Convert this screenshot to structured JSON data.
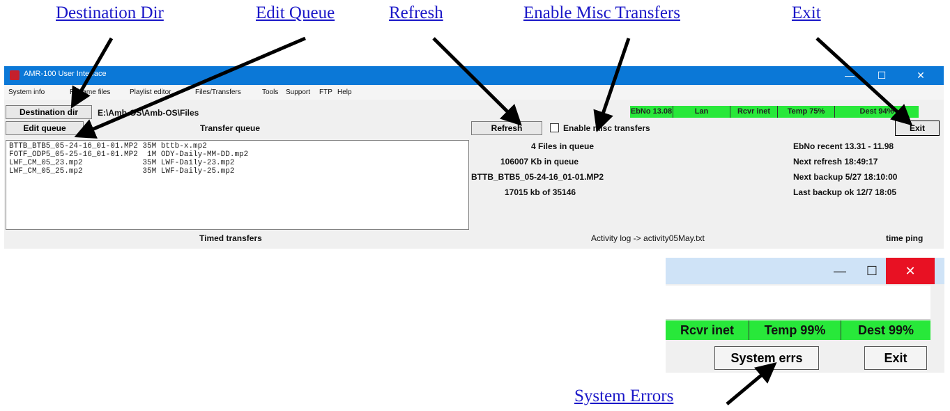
{
  "annotations": {
    "destination_dir": "Destination Dir",
    "edit_queue": "Edit Queue",
    "refresh": "Refresh",
    "enable_misc": "Enable Misc Transfers",
    "exit": "Exit",
    "system_errors": "System Errors"
  },
  "window": {
    "title": "AMR-100 User Interface",
    "menu": [
      "System info",
      "Rename files",
      "Playlist editor",
      "Files/Transfers",
      "Tools",
      "Support",
      "FTP",
      "Help"
    ],
    "destination_button": "Destination dir",
    "destination_path": "E:\\Amb-OS\\Amb-OS\\Files",
    "edit_queue_button": "Edit queue",
    "transfer_queue_label": "Transfer queue",
    "refresh_button": "Refresh",
    "enable_misc_label": "Enable misc transfers",
    "exit_button": "Exit",
    "status": {
      "ebno": "EbNo 13.08",
      "lan": "Lan",
      "rcvr": "Rcvr inet",
      "temp": "Temp 75%",
      "dest": "Dest 94%"
    },
    "queue_rows": [
      "BTTB_BTB5_05-24-16_01-01.MP2 35M bttb-x.mp2",
      "FOTF_ODP5_05-25-16_01-01.MP2  1M ODY-Daily-MM-DD.mp2",
      "LWF_CM_05_23.mp2             35M LWF-Daily-23.mp2",
      "LWF_CM_05_25.mp2             35M LWF-Daily-25.mp2"
    ],
    "info_center": [
      "4 Files in queue",
      "106007 Kb in queue",
      "BTTB_BTB5_05-24-16_01-01.MP2",
      "17015 kb of 35146"
    ],
    "info_right": [
      "EbNo recent 13.31 - 11.98",
      "Next refresh 18:49:17",
      "Next backup 5/27 18:10:00",
      "Last backup ok 12/7 18:05"
    ],
    "timed_transfers": "Timed transfers",
    "activity_log": "Activity log -> activity05May.txt",
    "time_ping": "time ping"
  },
  "window2": {
    "status": {
      "rcvr": "Rcvr inet",
      "temp": "Temp 99%",
      "dest": "Dest 99%"
    },
    "system_errs_button": "System errs",
    "exit_button": "Exit"
  },
  "colors": {
    "link": "#1a17c8",
    "titlebar": "#0b78d7",
    "status_green": "#28e83a",
    "close_red": "#e81123"
  }
}
